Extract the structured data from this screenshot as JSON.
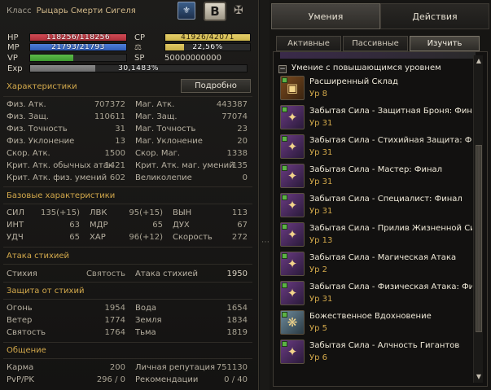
{
  "header": {
    "class_label": "Класс",
    "class_value": "Рыцарь Смерти Сигеля",
    "grade": "B"
  },
  "bars": {
    "hp": {
      "label": "HP",
      "value": "118256/118256",
      "fraction": 1.0
    },
    "mp": {
      "label": "MP",
      "value": "21793/21793",
      "fraction": 1.0
    },
    "vp": {
      "label": "VP",
      "value": "",
      "fraction": 0.45
    },
    "exp": {
      "label": "Exp",
      "value": "30,1483%",
      "fraction": 0.3
    },
    "cp": {
      "label": "CP",
      "value": "41926/42071",
      "fraction": 0.997
    },
    "weight": {
      "value": "22,56%",
      "fraction": 0.2256
    },
    "sp": {
      "label": "SP",
      "value": "50000000000"
    }
  },
  "characteristics": {
    "title": "Характеристики",
    "details_button": "Подробно",
    "rows": [
      {
        "l1": "Физ. Атк.",
        "v1": "707372",
        "l2": "Маг. Атк.",
        "v2": "443387"
      },
      {
        "l1": "Физ. Защ.",
        "v1": "110611",
        "l2": "Маг. Защ.",
        "v2": "77074"
      },
      {
        "l1": "Физ. Точность",
        "v1": "31",
        "l2": "Маг. Точность",
        "v2": "23"
      },
      {
        "l1": "Физ. Уклонение",
        "v1": "13",
        "l2": "Маг. Уклонение",
        "v2": "20"
      },
      {
        "l1": "Скор. Атк.",
        "v1": "1500",
        "l2": "Скор. Маг.",
        "v2": "1338"
      },
      {
        "l1": "Крит. Атк. обычных атак",
        "v1": "1421",
        "l2": "Крит. Атк. маг. умений",
        "v2": "135"
      },
      {
        "l1": "Крит. Атк. физ. умений",
        "v1": "602",
        "l2": "Великолепие",
        "v2": "0"
      }
    ]
  },
  "base_stats": {
    "title": "Базовые характеристики",
    "rows": [
      {
        "a": "СИЛ",
        "av": "135(+15)",
        "b": "ЛВК",
        "bv": "95(+15)",
        "c": "ВЫН",
        "cv": "113"
      },
      {
        "a": "ИНТ",
        "av": "63",
        "b": "МДР",
        "bv": "65",
        "c": "ДУХ",
        "cv": "67"
      },
      {
        "a": "УДЧ",
        "av": "65",
        "b": "ХАР",
        "bv": "96(+12)",
        "c": "Скорость",
        "cv": "272"
      }
    ]
  },
  "elemental_attack": {
    "title": "Атака стихией",
    "element_label": "Стихия",
    "element_value": "Святость",
    "attack_label": "Атака стихией",
    "attack_value": "1950"
  },
  "elemental_defense": {
    "title": "Защита от стихий",
    "rows": [
      {
        "l1": "Огонь",
        "v1": "1954",
        "l2": "Вода",
        "v2": "1654"
      },
      {
        "l1": "Ветер",
        "v1": "1774",
        "l2": "Земля",
        "v2": "1834"
      },
      {
        "l1": "Святость",
        "v1": "1764",
        "l2": "Тьма",
        "v2": "1819"
      }
    ]
  },
  "social": {
    "title": "Общение",
    "rows": [
      {
        "l1": "Карма",
        "v1": "200",
        "l2": "Личная репутация",
        "v2": "751130"
      },
      {
        "l1": "PvP/PK",
        "v1": "296 / 0",
        "l2": "Рекомендации",
        "v2": "0 / 40"
      }
    ]
  },
  "right": {
    "tabs": [
      "Умения",
      "Действия"
    ],
    "subtabs": [
      "Активные",
      "Пассивные",
      "Изучить умение"
    ],
    "category": "Умение с повышающимся уровнем",
    "skills": [
      {
        "name": "Расширенный Склад",
        "level": "Ур 8",
        "icon": "chest-icon"
      },
      {
        "name": "Забытая Сила - Защитная Броня: Финал",
        "level": "Ур 31",
        "icon": "book-icon"
      },
      {
        "name": "Забытая Сила - Стихийная Защита: Фин...",
        "level": "Ур 31",
        "icon": "book-icon"
      },
      {
        "name": "Забытая Сила - Мастер: Финал",
        "level": "Ур 31",
        "icon": "book-icon"
      },
      {
        "name": "Забытая Сила - Специалист: Финал",
        "level": "Ур 31",
        "icon": "book-icon"
      },
      {
        "name": "Забытая Сила - Прилив Жизненной Сил...",
        "level": "Ур 13",
        "icon": "book-icon"
      },
      {
        "name": "Забытая Сила - Магическая Атака",
        "level": "Ур 2",
        "icon": "book-icon"
      },
      {
        "name": "Забытая Сила - Физическая Атака: Фи...",
        "level": "Ур 31",
        "icon": "book-icon"
      },
      {
        "name": "Божественное Вдохновение",
        "level": "Ур 5",
        "icon": "wings-icon"
      },
      {
        "name": "Забытая Сила - Алчность Гигантов",
        "level": "Ур 6",
        "icon": "book-icon"
      }
    ]
  },
  "colors": {
    "hp": "#b0303a",
    "mp": "#2f5db8",
    "vp": "#3d9a2f",
    "cp": "#cdb64c",
    "weight": "#c8b04a",
    "exp": "#6b6b6b",
    "accent": "#d3a94b"
  }
}
